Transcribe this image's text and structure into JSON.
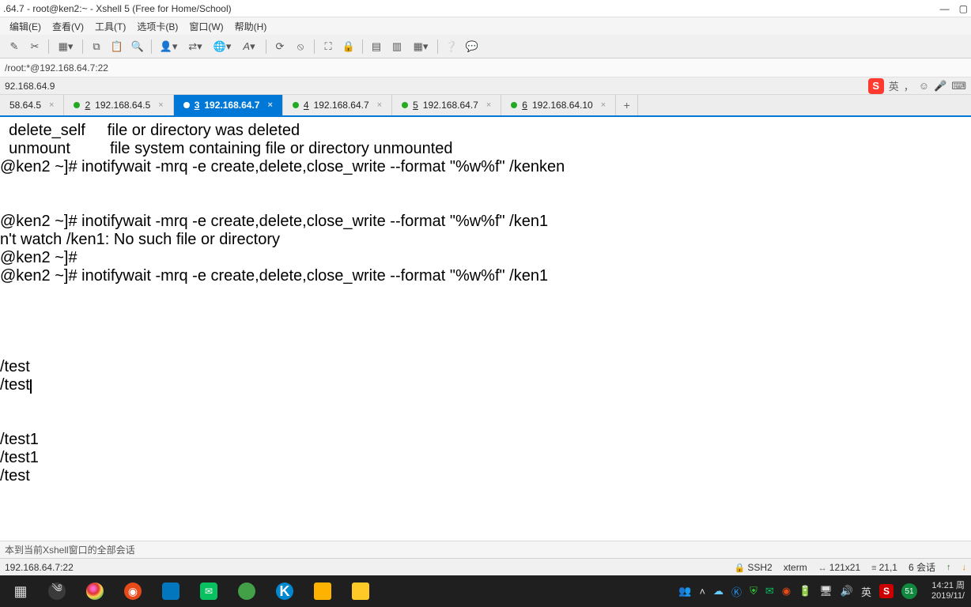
{
  "window": {
    "title": ".64.7 - root@ken2:~ - Xshell 5 (Free for Home/School)"
  },
  "menu": {
    "edit": "编辑(E)",
    "view": "查看(V)",
    "tools": "工具(T)",
    "tab": "选项卡(B)",
    "window": "窗口(W)",
    "help": "帮助(H)"
  },
  "address": "/root:*@192.168.64.7:22",
  "sidebarpath": "92.168.64.9",
  "ime": {
    "label": "英",
    "punct": "，",
    "smile": "☺",
    "mic": "🎤",
    "kbd": "⌨"
  },
  "tabs": [
    {
      "num": "",
      "label": "58.64.5",
      "active": false,
      "dot": false
    },
    {
      "num": "2",
      "label": "192.168.64.5",
      "active": false,
      "dot": true
    },
    {
      "num": "3",
      "label": "192.168.64.7",
      "active": true,
      "dot": true
    },
    {
      "num": "4",
      "label": "192.168.64.7",
      "active": false,
      "dot": true
    },
    {
      "num": "5",
      "label": "192.168.64.7",
      "active": false,
      "dot": true
    },
    {
      "num": "6",
      "label": "192.168.64.10",
      "active": false,
      "dot": true
    }
  ],
  "terminal_lines": [
    "  delete_self     file or directory was deleted",
    "  unmount         file system containing file or directory unmounted",
    "@ken2 ~]# inotifywait -mrq -e create,delete,close_write --format \"%w%f\" /kenken",
    "",
    "",
    "@ken2 ~]# inotifywait -mrq -e create,delete,close_write --format \"%w%f\" /ken1",
    "n't watch /ken1: No such file or directory",
    "@ken2 ~]#",
    "@ken2 ~]# inotifywait -mrq -e create,delete,close_write --format \"%w%f\" /ken1",
    "",
    "",
    "",
    "",
    "/test",
    "/test",
    "",
    "",
    "/test1",
    "/test1",
    "/test"
  ],
  "hint": "本到当前Xshell窗口的全部会话",
  "status": {
    "conn": "192.168.64.7:22",
    "proto": "SSH2",
    "term": "xterm",
    "size": "121x21",
    "cursor": "21,1",
    "sessions": "6 会话"
  },
  "clock": {
    "time": "14:21 周",
    "date": "2019/11/"
  },
  "tray": {
    "ime": "英",
    "badge": "51"
  }
}
